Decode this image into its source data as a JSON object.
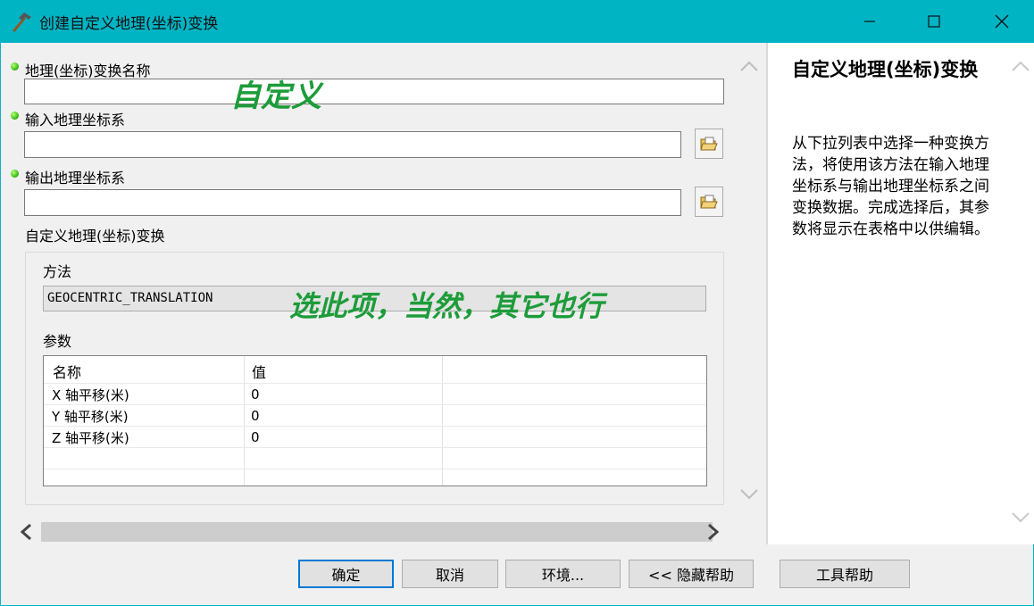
{
  "window": {
    "title": "创建自定义地理(坐标)变换",
    "icon": "hammer-icon",
    "controls": [
      "minimize-icon",
      "maximize-icon",
      "close-icon"
    ]
  },
  "form": {
    "transform_name": {
      "label": "地理(坐标)变换名称",
      "value": ""
    },
    "input_gcs": {
      "label": "输入地理坐标系",
      "value": "",
      "browse_icon": "open-folder-icon"
    },
    "output_gcs": {
      "label": "输出地理坐标系",
      "value": "",
      "browse_icon": "open-folder-icon"
    },
    "custom_transform_label": "自定义地理(坐标)变换",
    "method": {
      "label": "方法",
      "value": "GEOCENTRIC_TRANSLATION"
    },
    "parameters": {
      "label": "参数",
      "columns": [
        "名称",
        "值"
      ],
      "rows": [
        {
          "name": "X 轴平移(米)",
          "value": "0"
        },
        {
          "name": "Y 轴平移(米)",
          "value": "0"
        },
        {
          "name": "Z 轴平移(米)",
          "value": "0"
        }
      ]
    }
  },
  "annotations": {
    "name_note": "自定义",
    "method_note": "选此项，当然，其它也行"
  },
  "help": {
    "title": "自定义地理(坐标)变换",
    "body": "从下拉列表中选择一种变换方法，将使用该方法在输入地理坐标系与输出地理坐标系之间变换数据。完成选择后，其参数将显示在表格中以供编辑。"
  },
  "buttons": {
    "ok": "确定",
    "cancel": "取消",
    "environments": "环境...",
    "hide_help": "<< 隐藏帮助",
    "tool_help": "工具帮助"
  },
  "colors": {
    "titlebar": "#00b4c4",
    "annotation": "#1d9c3a",
    "required_bullet": "#3fbf19",
    "default_button_border": "#0078d7"
  }
}
